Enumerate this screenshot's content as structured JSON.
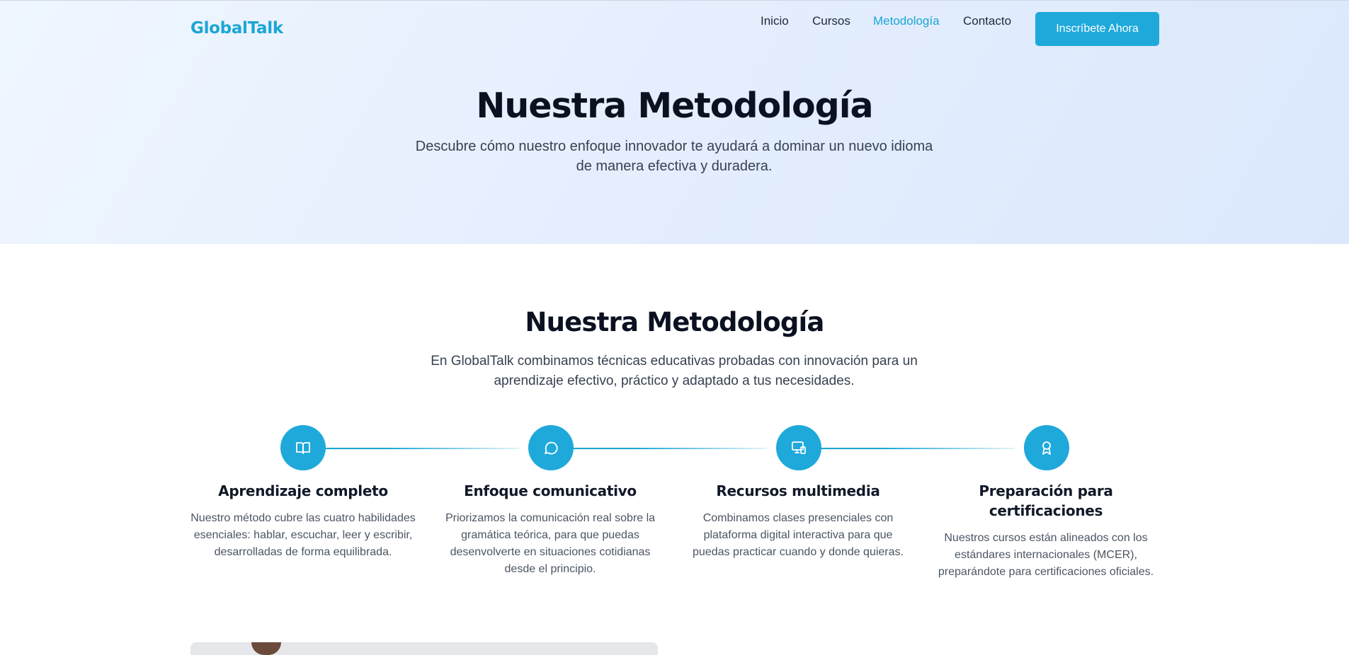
{
  "nav": {
    "logo": "GlobalTalk",
    "links": [
      "Inicio",
      "Cursos",
      "Metodología",
      "Contacto"
    ],
    "active": "Metodología",
    "cta": "Inscríbete Ahora"
  },
  "hero": {
    "title": "Nuestra Metodología",
    "subtitle": "Descubre cómo nuestro enfoque innovador te ayudará a dominar un nuevo idioma de manera efectiva y duradera."
  },
  "methodology": {
    "title": "Nuestra Metodología",
    "subtitle": "En GlobalTalk combinamos técnicas educativas probadas con innovación para un aprendizaje efectivo, práctico y adaptado a tus necesidades.",
    "steps": [
      {
        "icon": "book-open-icon",
        "title": "Aprendizaje completo",
        "description": "Nuestro método cubre las cuatro habilidades esenciales: hablar, escuchar, leer y escribir, desarrolladas de forma equilibrada."
      },
      {
        "icon": "chat-bubble-icon",
        "title": "Enfoque comunicativo",
        "description": "Priorizamos la comunicación real sobre la gramática teórica, para que puedas desenvolverte en situaciones cotidianas desde el principio."
      },
      {
        "icon": "devices-icon",
        "title": "Recursos multimedia",
        "description": "Combinamos clases presenciales con plataforma digital interactiva para que puedas practicar cuando y donde quieras."
      },
      {
        "icon": "award-icon",
        "title": "Preparación para certificaciones",
        "description": "Nuestros cursos están alineados con los estándares internacionales (MCER), preparándote para certificaciones oficiales."
      }
    ]
  },
  "colors": {
    "accent": "#1fa9db",
    "heading": "#0b1120",
    "body_text": "#4b5563"
  }
}
